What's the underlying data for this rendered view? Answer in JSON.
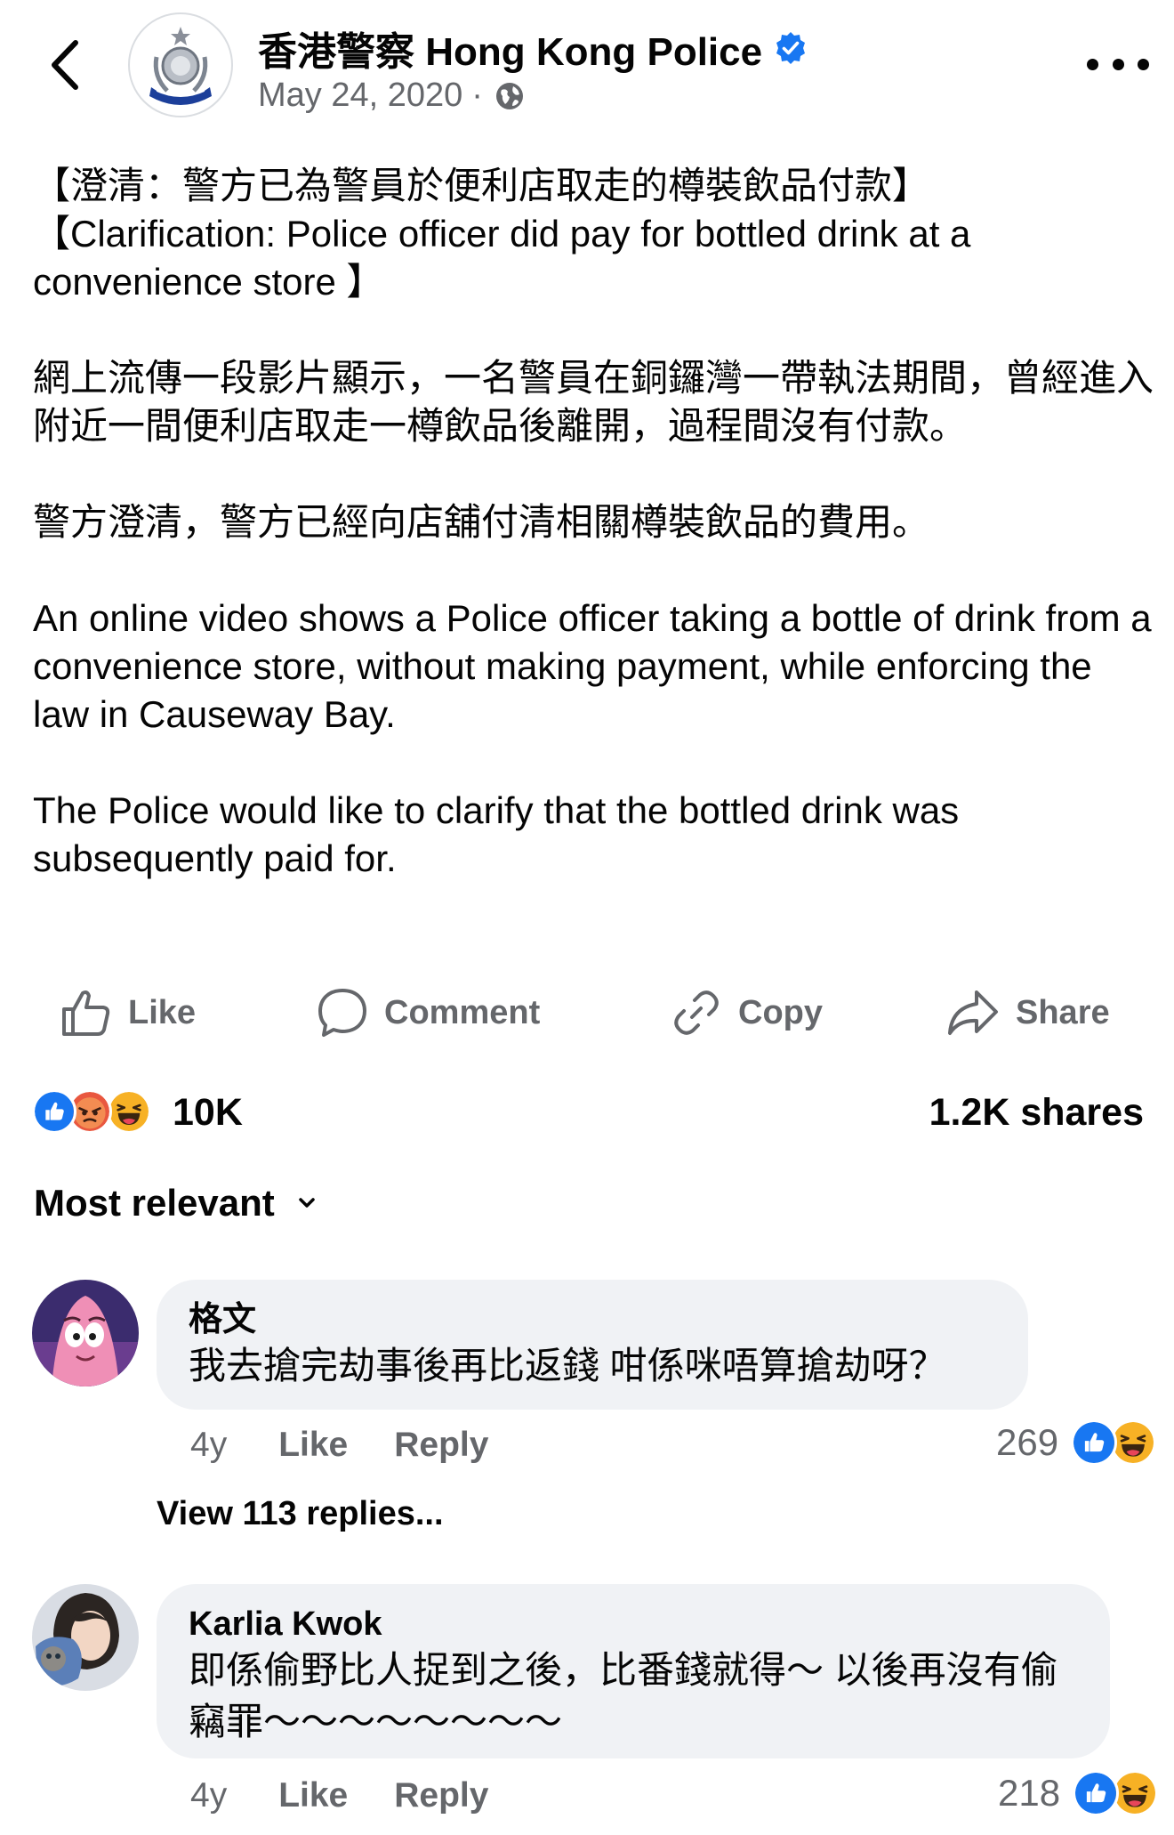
{
  "header": {
    "page_name": "香港警察 Hong Kong Police",
    "date": "May 24, 2020",
    "separator": "·",
    "icons": {
      "back": "chevron-left-icon",
      "verified": "verified-badge-icon",
      "audience": "globe-icon",
      "more": "more-horizontal-icon"
    }
  },
  "post": {
    "paragraphs": [
      "【澄清：警方已為警員於便利店取走的樽裝飲品付款】\n【Clarification: Police officer did pay for bottled drink at a convenience store 】",
      "網上流傳一段影片顯示，一名警員在銅鑼灣一帶執法期間，曾經進入附近一間便利店取走一樽飲品後離開，過程間沒有付款。",
      "警方澄清，警方已經向店舖付清相關樽裝飲品的費用。",
      "An online video shows a Police officer taking a bottle of drink from a convenience store, without making payment, while enforcing the law in Causeway Bay.",
      "The Police would like to clarify that the bottled drink was subsequently paid for."
    ]
  },
  "actions": {
    "like": "Like",
    "comment": "Comment",
    "copy": "Copy",
    "share": "Share"
  },
  "summary": {
    "reaction_icons": [
      "like-reaction-icon",
      "angry-reaction-icon",
      "haha-reaction-icon"
    ],
    "reaction_count": "10K",
    "shares": "1.2K shares"
  },
  "sort": {
    "label": "Most relevant"
  },
  "comments": [
    {
      "author": "格文",
      "text": "我去搶完劫事後再比返錢 咁係咪唔算搶劫呀？",
      "age": "4y",
      "like": "Like",
      "reply": "Reply",
      "reaction_count": "269",
      "reaction_icons": [
        "like-reaction-icon",
        "haha-reaction-icon"
      ]
    },
    {
      "author": "Karlia Kwok",
      "text": "即係偷野比人捉到之後，比番錢就得～ 以後再沒有偷竊罪～～～～～～～～",
      "age": "4y",
      "like": "Like",
      "reply": "Reply",
      "reaction_count": "218",
      "reaction_icons": [
        "like-reaction-icon",
        "haha-reaction-icon"
      ]
    }
  ],
  "view_replies": "View 113 replies...",
  "colors": {
    "text_primary": "#050505",
    "text_secondary": "#65676b",
    "bubble_bg": "#f0f2f5",
    "facebook_blue": "#1877f2",
    "angry_red": "#e9573f",
    "haha_yellow": "#f7b125"
  }
}
